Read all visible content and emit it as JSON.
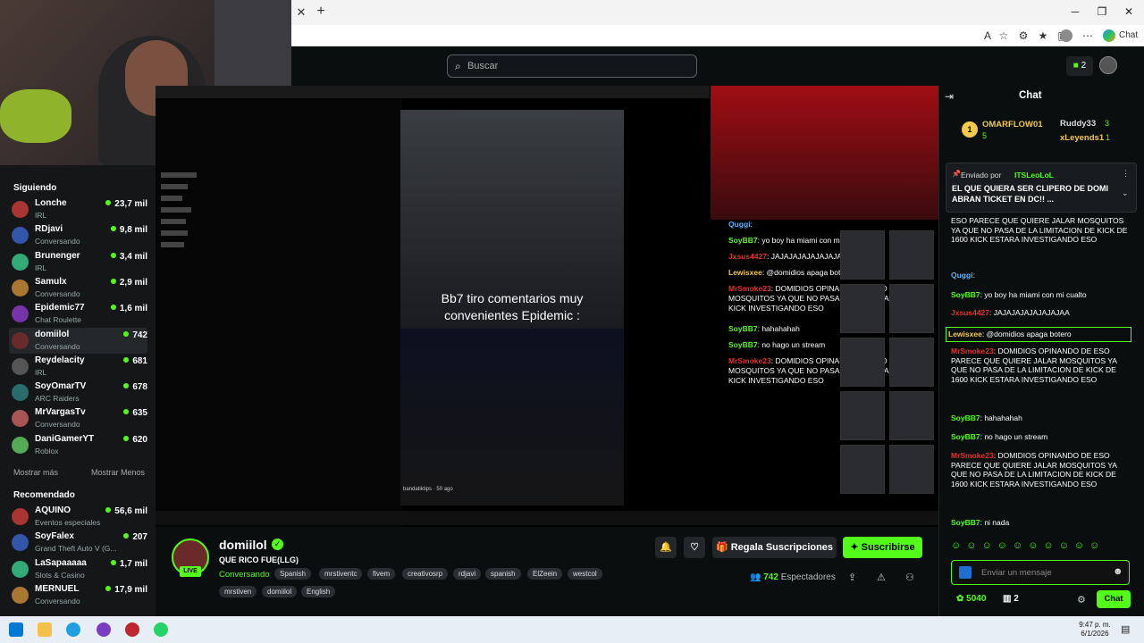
{
  "browser": {
    "chat_label": "Chat"
  },
  "search": {
    "placeholder": "Buscar"
  },
  "topnav": {
    "badge_count": "2"
  },
  "sidebar": {
    "following_heading": "Siguiendo",
    "following": [
      {
        "name": "Lonche",
        "sub": "IRL",
        "viewers": "23,7 mil"
      },
      {
        "name": "RDjavi",
        "sub": "Conversando",
        "viewers": "9,8 mil"
      },
      {
        "name": "Brunenger",
        "sub": "IRL",
        "viewers": "3,4 mil"
      },
      {
        "name": "Samulx",
        "sub": "Conversando",
        "viewers": "2,9 mil"
      },
      {
        "name": "Epidemic77",
        "sub": "Chat Roulette",
        "viewers": "1,6 mil"
      },
      {
        "name": "domiilol",
        "sub": "Conversando",
        "viewers": "742"
      },
      {
        "name": "Reydelacity",
        "sub": "IRL",
        "viewers": "681"
      },
      {
        "name": "SoyOmarTV",
        "sub": "ARC Raiders",
        "viewers": "678"
      },
      {
        "name": "MrVargasTv",
        "sub": "Conversando",
        "viewers": "635"
      },
      {
        "name": "DaniGamerYT",
        "sub": "Roblox",
        "viewers": "620"
      }
    ],
    "show_more": "Mostrar más",
    "show_less": "Mostrar Menos",
    "recommended_heading": "Recomendado",
    "recommended": [
      {
        "name": "AQUINO",
        "sub": "Eventos especiales",
        "viewers": "56,6 mil"
      },
      {
        "name": "SoyFalex",
        "sub": "Grand Theft Auto V (G...",
        "viewers": "207"
      },
      {
        "name": "LaSapaaaaa",
        "sub": "Slots & Casino",
        "viewers": "1,7 mil"
      },
      {
        "name": "MERNUEL",
        "sub": "Conversando",
        "viewers": "17,9 mil"
      }
    ]
  },
  "video": {
    "caption": "Bb7 tiro comentarios muy convenientes Epidemic :",
    "band_tag": "bandatiktips · 50 ago",
    "inner_chat": [
      {
        "user": "Quggi",
        "text": ":"
      },
      {
        "user": "SoyBB7",
        "text": ": yo boy ha miami con mi cualto"
      },
      {
        "user": "Jxsus4427",
        "text": ": JAJAJAJAJAJAJAJAA"
      },
      {
        "user": "Lewisxee",
        "text": ": @domidios apaga botero"
      },
      {
        "user": "MrSmoke23",
        "text": ": DOMIDIOS OPINANDO DE ESO PARE MOSQUITOS YA QUE NO PASA DE LA LIMITACION DE KICK INVESTIGANDO ESO"
      },
      {
        "user": "SoyBB7",
        "text": ": hahahahah"
      },
      {
        "user": "SoyBB7",
        "text": ": no hago un stream"
      },
      {
        "user": "MrSmoke23",
        "text": ": DOMIDIOS OPINANDO DE ESO PARE MOSQUITOS YA QUE NO PASA DE LA LIMITACION DE KICK INVESTIGANDO ESO"
      }
    ]
  },
  "stream": {
    "channel": "domiilol",
    "live": "LIVE",
    "title": "QUE RICO FUE(LLG)",
    "category": "Conversando",
    "tags": [
      "Spanish",
      "mrstiventc",
      "fivem",
      "creativosrp",
      "rdjavi",
      "spanish",
      "ElZeein",
      "westcol",
      "mrstiven",
      "domiilol",
      "English"
    ],
    "gift_subs": "Regala Suscripciones",
    "subscribe": "Suscribirse",
    "viewers": "742",
    "viewers_label": "Espectadores"
  },
  "chat": {
    "title": "Chat",
    "leaderboard": [
      {
        "rank": "1",
        "name": "OMARFLOW01",
        "count": "5"
      },
      {
        "name": "Ruddy33",
        "count": "3"
      },
      {
        "name": "xLeyends1",
        "count": "1"
      }
    ],
    "pinned_by_label": "Enviado por",
    "pinned_by": "ITSLeoLoL",
    "pinned_text": "EL QUE QUIERA SER CLIPERO DE DOMI ABRAN TICKET EN DC!! ...",
    "messages": [
      {
        "user": "",
        "text": "ESO PARECE QUE QUIERE JALAR MOSQUITOS YA QUE NO PASA DE LA LIMITACION DE KICK DE 1600 KICK ESTARA INVESTIGANDO ESO"
      },
      {
        "user": "Quggi",
        "text": ":"
      },
      {
        "user": "SoyBB7",
        "text": ": yo boy ha miami con mi cualto"
      },
      {
        "user": "Jxsus4427",
        "text": ": JAJAJAJAJAJAJAJAA"
      },
      {
        "user": "Lewisxee",
        "text": ": @domidios apaga botero"
      },
      {
        "user": "MrSmoke23",
        "text": ": DOMIDIOS OPINANDO DE ESO PARECE QUE QUIERE JALAR MOSQUITOS YA QUE NO PASA DE LA LIMITACION DE KICK DE 1600 KICK ESTARA INVESTIGANDO ESO"
      },
      {
        "user": "SoyBB7",
        "text": ": hahahahah"
      },
      {
        "user": "SoyBB7",
        "text": ": no hago un stream"
      },
      {
        "user": "MrSmoke23",
        "text": ": DOMIDIOS OPINANDO DE ESO PARECE QUE QUIERE JALAR MOSQUITOS YA QUE NO PASA DE LA LIMITACION DE KICK DE 1600 KICK ESTARA INVESTIGANDO ESO"
      },
      {
        "user": "SoyBB7",
        "text": ": ni nada"
      }
    ],
    "input_placeholder": "Enviar un mensaje",
    "points": "5040",
    "gifts": "2",
    "send": "Chat"
  },
  "taskbar": {
    "time": "9:47 p. m.",
    "date": "6/1/2026"
  },
  "colors": {
    "kick_green": "#53fc18",
    "bg": "#0b0e0f",
    "user_green": "#53fc18",
    "user_red": "#e0342f",
    "user_yellow": "#f2c94c"
  }
}
